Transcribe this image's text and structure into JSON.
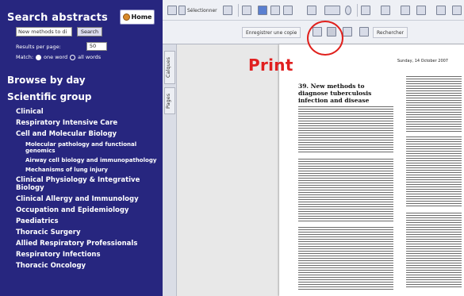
{
  "sidebar": {
    "title": "Search abstracts",
    "home_label": "Home",
    "search_value": "New methods to di",
    "search_button": "Search",
    "results_per_page_label": "Results per page:",
    "results_per_page_value": "50",
    "match_label": "Match:",
    "match_option_1": "one word",
    "match_option_2": "all words",
    "browse_by_day": "Browse by day",
    "scientific_group": "Scientific group",
    "categories": [
      "Clinical",
      "Respiratory Intensive Care",
      "Cell and Molecular Biology",
      "Molecular pathology and functional genomics",
      "Airway cell biology and immunopathology",
      "Mechanisms of lung injury",
      "Clinical Physiology & Integrative Biology",
      "Clinical Allergy and Immunology",
      "Occupation and Epidemiology",
      "Paediatrics",
      "Thoracic Surgery",
      "Allied Respiratory Professionals",
      "Respiratory Infections",
      "Thoracic Oncology"
    ]
  },
  "toolbar": {
    "select_label": "Sélectionner",
    "save_label": "Enregistrer une copie",
    "restore_label": "Rechercher"
  },
  "annotation": {
    "print_label": "Print",
    "color": "#e02020"
  },
  "viewer": {
    "tab_pages": "Pages",
    "tab_calques": "Calques",
    "page_date": "Sunday, 14 October 2007",
    "abstract_title": "39. New methods to diagnose tuberculosis infection and disease"
  }
}
